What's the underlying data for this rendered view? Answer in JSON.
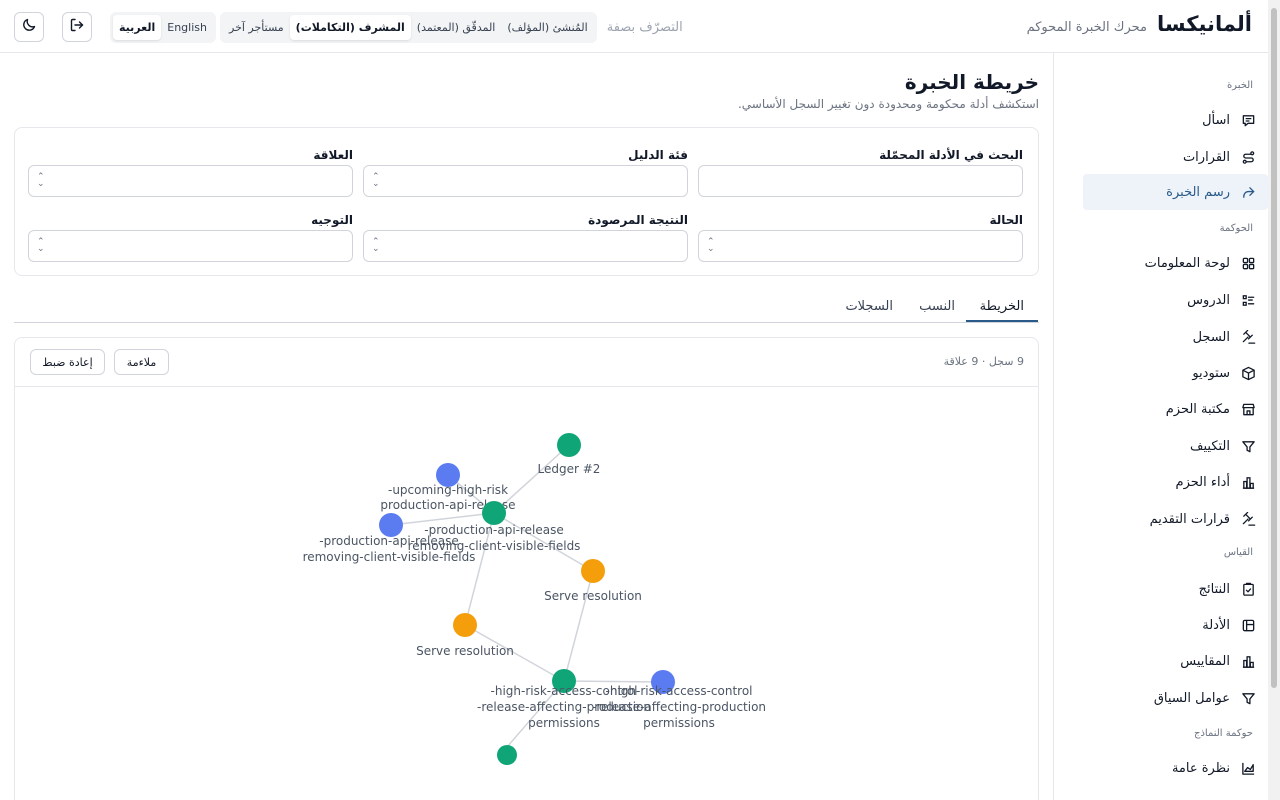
{
  "header": {
    "brand": "ألمانيكسا",
    "tagline": "محرك الخبرة المحوكم",
    "persona_label": "التصرّف بصفة",
    "personas": [
      "المُنشئ (المؤلف)",
      "المدقّق (المعتمد)",
      "المشرف (التكاملات)",
      "مستأجر آخر"
    ],
    "active_persona": "المشرف (التكاملات)",
    "languages": [
      "English",
      "العربية"
    ],
    "active_language": "العربية"
  },
  "sidebar": {
    "sections": [
      {
        "title": "الخبرة",
        "items": [
          {
            "label": "اسأل",
            "icon": "chat-icon"
          },
          {
            "label": "القرارات",
            "icon": "route-icon"
          },
          {
            "label": "رسم الخبرة",
            "icon": "share-icon",
            "active": true
          }
        ]
      },
      {
        "title": "الحوكمة",
        "items": [
          {
            "label": "لوحة المعلومات",
            "icon": "grid-icon"
          },
          {
            "label": "الدروس",
            "icon": "list-icon"
          },
          {
            "label": "السجل",
            "icon": "gavel-icon"
          },
          {
            "label": "ستوديو",
            "icon": "box-icon"
          },
          {
            "label": "مكتبة الحزم",
            "icon": "store-icon"
          },
          {
            "label": "التكييف",
            "icon": "filter-icon"
          },
          {
            "label": "أداء الحزم",
            "icon": "bar-chart-icon"
          },
          {
            "label": "قرارات التقديم",
            "icon": "gavel-icon"
          }
        ]
      },
      {
        "title": "القياس",
        "items": [
          {
            "label": "النتائج",
            "icon": "clipboard-check-icon"
          },
          {
            "label": "الأدلة",
            "icon": "evidence-icon"
          },
          {
            "label": "المقاييس",
            "icon": "bar-chart-icon"
          },
          {
            "label": "عوامل السياق",
            "icon": "filter-icon"
          }
        ]
      },
      {
        "title": "حوكمة النماذج",
        "items": [
          {
            "label": "نظرة عامة",
            "icon": "area-chart-icon"
          }
        ]
      }
    ]
  },
  "page": {
    "title": "خريطة الخبرة",
    "subtitle": "استكشف أدلة محكومة ومحدودة دون تغيير السجل الأساسي."
  },
  "filters": {
    "search_label": "البحث في الأدلة المحمّلة",
    "category_label": "فئة الدليل",
    "relation_label": "العلاقة",
    "status_label": "الحالة",
    "outcome_label": "النتيجة المرصودة",
    "direction_label": "التوجيه"
  },
  "tabs": [
    "الخريطة",
    "النسب",
    "السجلات"
  ],
  "active_tab": "الخريطة",
  "graph_panel": {
    "counts": "9 سجل · 9 علاقة",
    "fit_label": "ملاءمة",
    "reset_label": "إعادة ضبط",
    "nodes": [
      {
        "lines": [
          "upcoming-high-risk-",
          "production-api-release"
        ],
        "color": "#5b7cf0"
      },
      {
        "lines": [
          "Ledger #2"
        ],
        "color": "#10a577"
      },
      {
        "lines": [
          "production-api-release-",
          "removing-client-visible-fields"
        ],
        "color": "#10a577"
      },
      {
        "lines": [
          "production-api-release-",
          "removing-client-visible-fields"
        ],
        "color": "#5b7cf0"
      },
      {
        "lines": [
          "Serve resolution"
        ],
        "color": "#f59e0b"
      },
      {
        "lines": [
          "Serve resolution"
        ],
        "color": "#f59e0b"
      },
      {
        "lines": [
          "high-risk-access-control-",
          "release-affecting-production-",
          "permissions"
        ],
        "color": "#10a577"
      },
      {
        "lines": [
          "high-risk-access-control-",
          "release-affecting-production-",
          "permissions"
        ],
        "color": "#5b7cf0"
      }
    ]
  }
}
